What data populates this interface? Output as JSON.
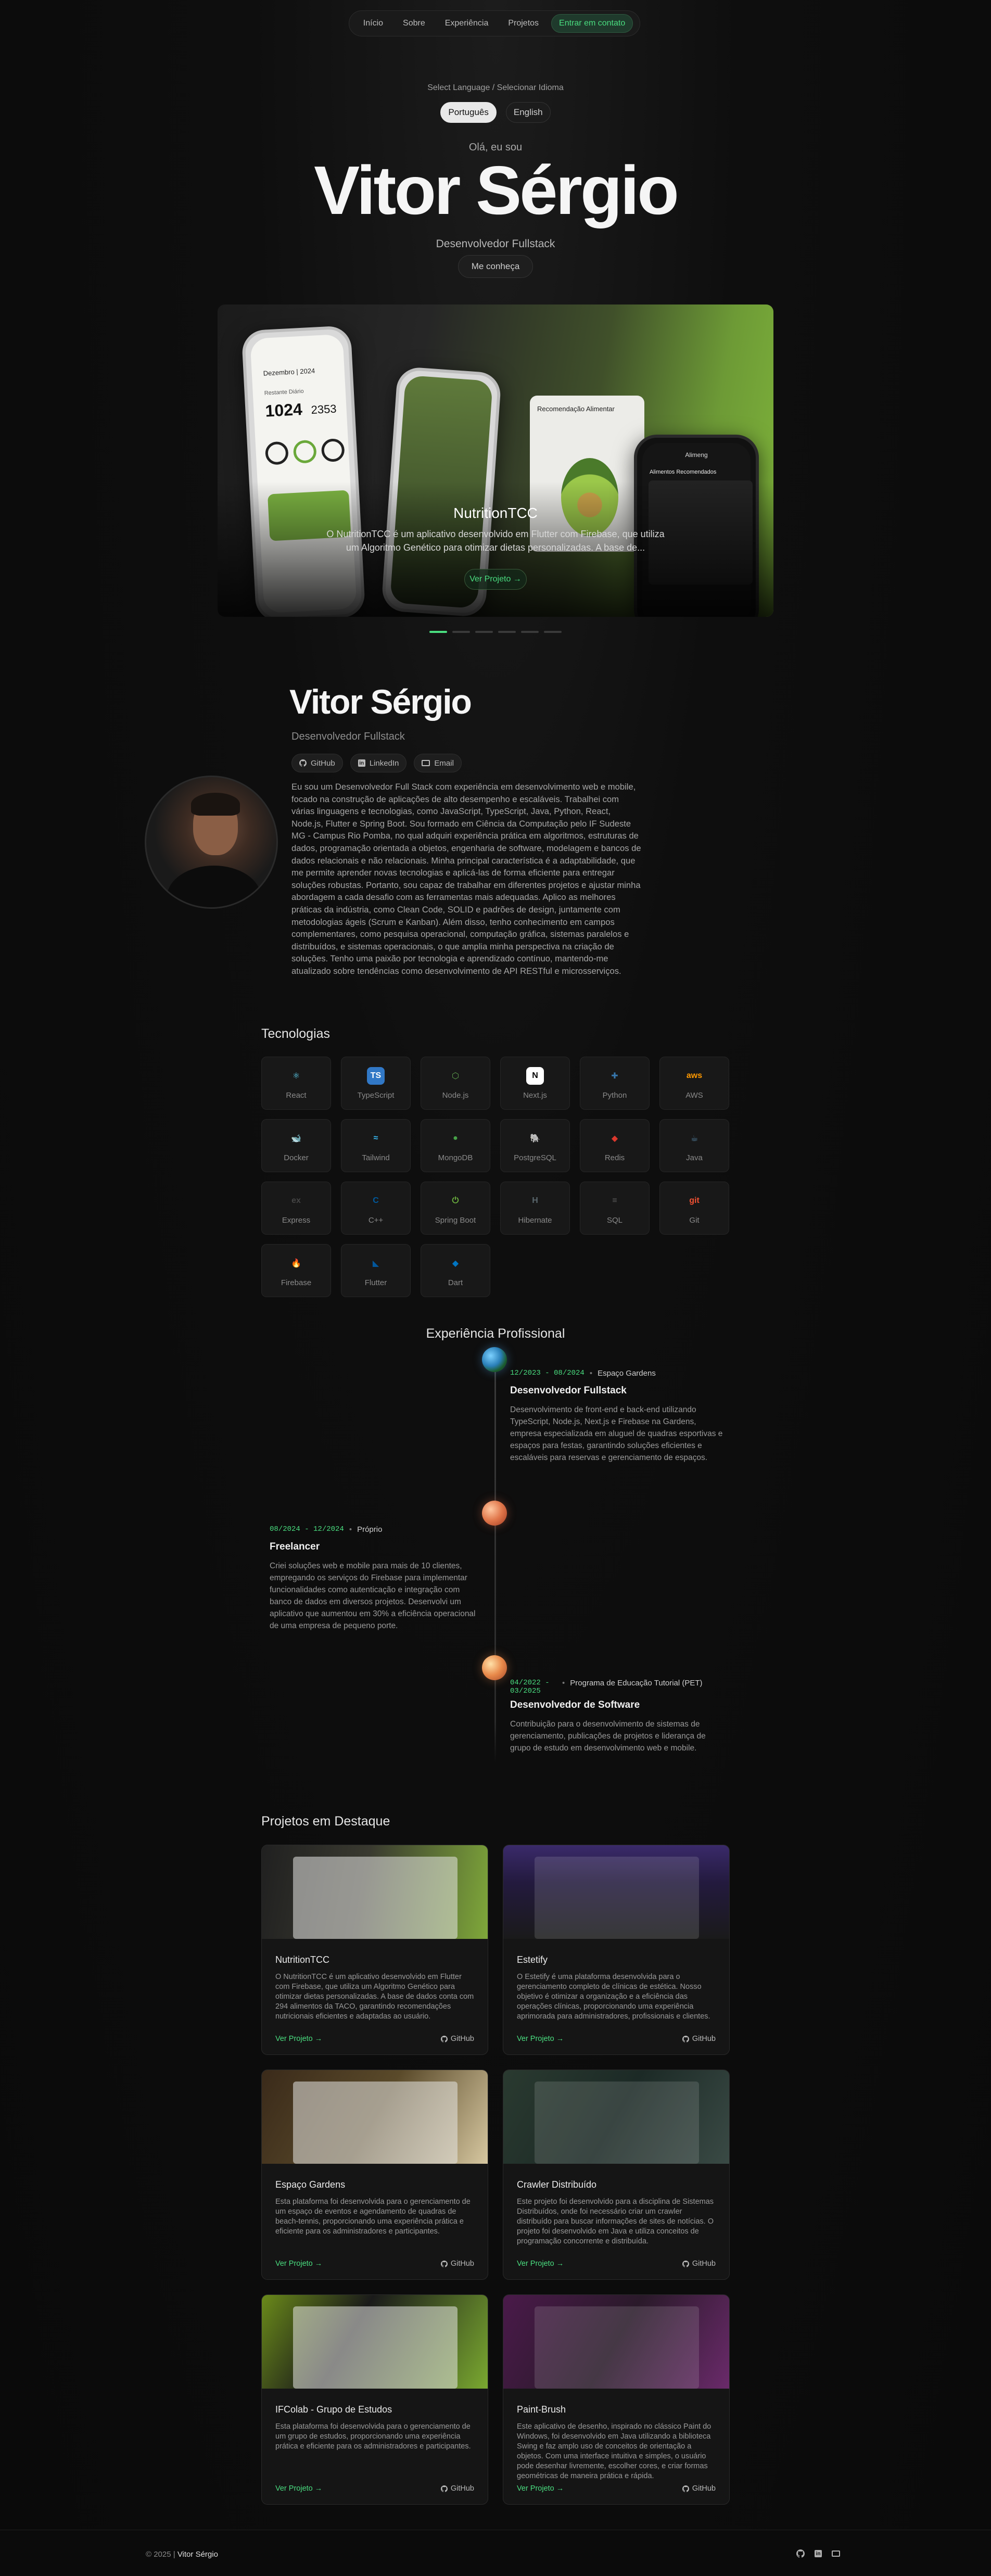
{
  "nav": {
    "items": [
      "Início",
      "Sobre",
      "Experiência",
      "Projetos"
    ],
    "cta": "Entrar em contato"
  },
  "hero": {
    "language_label": "Select Language / Selecionar Idioma",
    "languages": [
      "Português",
      "English"
    ],
    "active_language": "Português",
    "greeting": "Olá, eu sou",
    "name": "Vitor Sérgio",
    "role": "Desenvolvedor Fullstack",
    "meet_button": "Me conheça"
  },
  "carousel": {
    "title": "NutritionTCC",
    "description": "O NutritionTCC é um aplicativo desenvolvido em Flutter com Firebase, que utiliza um Algoritmo Genético para otimizar dietas personalizadas. A base de...",
    "button": "Ver Projeto →",
    "slides_count": 6,
    "active_slide": 1,
    "phone_texts": {
      "date": "Dezembro | 2024",
      "remaining": "Restante Diário",
      "kcal": "1024",
      "kcal2": "2353",
      "rec_title": "Recomendação Alimentar",
      "food_title": "Alimentos Recomendados",
      "brand": "Alimeng"
    }
  },
  "about": {
    "name": "Vitor Sérgio",
    "role": "Desenvolvedor Fullstack",
    "social": [
      "GitHub",
      "LinkedIn",
      "Email"
    ],
    "bio": "Eu sou um Desenvolvedor Full Stack com experiência em desenvolvimento web e mobile, focado na construção de aplicações de alto desempenho e escaláveis. Trabalhei com várias linguagens e tecnologias, como JavaScript, TypeScript, Java, Python, React, Node.js, Flutter e Spring Boot. Sou formado em Ciência da Computação pelo IF Sudeste MG - Campus Rio Pomba, no qual adquiri experiência prática em algoritmos, estruturas de dados, programação orientada a objetos, engenharia de software, modelagem e bancos de dados relacionais e não relacionais. Minha principal característica é a adaptabilidade, que me permite aprender novas tecnologias e aplicá-las de forma eficiente para entregar soluções robustas. Portanto, sou capaz de trabalhar em diferentes projetos e ajustar minha abordagem a cada desafio com as ferramentas mais adequadas. Aplico as melhores práticas da indústria, como Clean Code, SOLID e padrões de design, juntamente com metodologias ágeis (Scrum e Kanban). Além disso, tenho conhecimento em campos complementares, como pesquisa operacional, computação gráfica, sistemas paralelos e distribuídos, e sistemas operacionais, o que amplia minha perspectiva na criação de soluções. Tenho uma paixão por tecnologia e aprendizado contínuo, mantendo-me atualizado sobre tendências como desenvolvimento de API RESTful e microsserviços."
  },
  "tech": {
    "title": "Tecnologias",
    "items": [
      {
        "name": "React",
        "icon": "react-icon",
        "glyph": "⚛",
        "color": "#61dafb",
        "bg": "transparent"
      },
      {
        "name": "TypeScript",
        "icon": "typescript-icon",
        "glyph": "TS",
        "color": "#ffffff",
        "bg": "#3178c6"
      },
      {
        "name": "Node.js",
        "icon": "nodejs-icon",
        "glyph": "⬡",
        "color": "#5fa04e",
        "bg": "transparent"
      },
      {
        "name": "Next.js",
        "icon": "nextjs-icon",
        "glyph": "N",
        "color": "#000000",
        "bg": "#ffffff"
      },
      {
        "name": "Python",
        "icon": "python-icon",
        "glyph": "✚",
        "color": "#3776ab",
        "bg": "transparent"
      },
      {
        "name": "AWS",
        "icon": "aws-icon",
        "glyph": "aws",
        "color": "#ff9900",
        "bg": "transparent"
      },
      {
        "name": "Docker",
        "icon": "docker-icon",
        "glyph": "🐋",
        "color": "#2496ed",
        "bg": "transparent"
      },
      {
        "name": "Tailwind",
        "icon": "tailwind-icon",
        "glyph": "≈",
        "color": "#38bdf8",
        "bg": "transparent"
      },
      {
        "name": "MongoDB",
        "icon": "mongodb-icon",
        "glyph": "●",
        "color": "#47a248",
        "bg": "transparent"
      },
      {
        "name": "PostgreSQL",
        "icon": "postgresql-icon",
        "glyph": "🐘",
        "color": "#336791",
        "bg": "transparent"
      },
      {
        "name": "Redis",
        "icon": "redis-icon",
        "glyph": "◆",
        "color": "#dc382d",
        "bg": "transparent"
      },
      {
        "name": "Java",
        "icon": "java-icon",
        "glyph": "☕",
        "color": "#5382a1",
        "bg": "transparent"
      },
      {
        "name": "Express",
        "icon": "express-icon",
        "glyph": "ex",
        "color": "#444444",
        "bg": "transparent"
      },
      {
        "name": "C++",
        "icon": "cpp-icon",
        "glyph": "C",
        "color": "#00599c",
        "bg": "transparent"
      },
      {
        "name": "Spring Boot",
        "icon": "spring-boot-icon",
        "glyph": "⏻",
        "color": "#6db33f",
        "bg": "transparent"
      },
      {
        "name": "Hibernate",
        "icon": "hibernate-icon",
        "glyph": "H",
        "color": "#59666c",
        "bg": "transparent"
      },
      {
        "name": "SQL",
        "icon": "sql-icon",
        "glyph": "≡",
        "color": "#5a5a5a",
        "bg": "transparent"
      },
      {
        "name": "Git",
        "icon": "git-icon",
        "glyph": "git",
        "color": "#f05032",
        "bg": "transparent"
      },
      {
        "name": "Firebase",
        "icon": "firebase-icon",
        "glyph": "🔥",
        "color": "#ffca28",
        "bg": "transparent"
      },
      {
        "name": "Flutter",
        "icon": "flutter-icon",
        "glyph": "◣",
        "color": "#02569b",
        "bg": "transparent"
      },
      {
        "name": "Dart",
        "icon": "dart-icon",
        "glyph": "◆",
        "color": "#0175c2",
        "bg": "transparent"
      }
    ]
  },
  "experience": {
    "title": "Experiência Profissional",
    "items": [
      {
        "date": "12/2023 - 08/2024",
        "org": "Espaço Gardens",
        "role": "Desenvolvedor Fullstack",
        "desc": "Desenvolvimento de front-end e back-end utilizando TypeScript, Node.js, Next.js e Firebase na Gardens, empresa especializada em aluguel de quadras esportivas e espaços para festas, garantindo soluções eficientes e escaláveis para reservas e gerenciamento de espaços."
      },
      {
        "date": "08/2024 - 12/2024",
        "org": "Próprio",
        "role": "Freelancer",
        "desc": "Criei soluções web e mobile para mais de 10 clientes, empregando os serviços do Firebase para implementar funcionalidades como autenticação e integração com banco de dados em diversos projetos. Desenvolvi um aplicativo que aumentou em 30% a eficiência operacional de uma empresa de pequeno porte."
      },
      {
        "date": "04/2022 - 03/2025",
        "org": "Programa de Educação Tutorial (PET)",
        "role": "Desenvolvedor de Software",
        "desc": "Contribuição para o desenvolvimento de sistemas de gerenciamento, publicações de projetos e liderança de grupo de estudo em desenvolvimento web e mobile."
      }
    ]
  },
  "projects": {
    "title": "Projetos em Destaque",
    "view_label": "Ver Projeto →",
    "github_label": "GitHub",
    "items": [
      {
        "name": "NutritionTCC",
        "desc": "O NutritionTCC é um aplicativo desenvolvido em Flutter com Firebase, que utiliza um Algoritmo Genético para otimizar dietas personalizadas. A base de dados conta com 294 alimentos da TACO, garantindo recomendações nutricionais eficientes e adaptadas ao usuário."
      },
      {
        "name": "Estetify",
        "desc": "O Estetify é uma plataforma desenvolvida para o gerenciamento completo de clínicas de estética. Nosso objetivo é otimizar a organização e a eficiência das operações clínicas, proporcionando uma experiência aprimorada para administradores, profissionais e clientes."
      },
      {
        "name": "Espaço Gardens",
        "desc": "Esta plataforma foi desenvolvida para o gerenciamento de um espaço de eventos e agendamento de quadras de beach-tennis, proporcionando uma experiência prática e eficiente para os administradores e participantes."
      },
      {
        "name": "Crawler Distribuído",
        "desc": "Este projeto foi desenvolvido para a disciplina de Sistemas Distribuídos, onde foi necessário criar um crawler distribuído para buscar informações de sites de notícias. O projeto foi desenvolvido em Java e utiliza conceitos de programação concorrente e distribuída."
      },
      {
        "name": "IFColab - Grupo de Estudos",
        "desc": "Esta plataforma foi desenvolvida para o gerenciamento de um grupo de estudos, proporcionando uma experiência prática e eficiente para os administradores e participantes."
      },
      {
        "name": "Paint-Brush",
        "desc": "Este aplicativo de desenho, inspirado no clássico Paint do Windows, foi desenvolvido em Java utilizando a biblioteca Swing e faz amplo uso de conceitos de orientação a objetos. Com uma interface intuitiva e simples, o usuário pode desenhar livremente, escolher cores, e criar formas geométricas de maneira prática e rápida."
      }
    ]
  },
  "footer": {
    "copy": "© 2025 |",
    "name": "Vitor Sérgio",
    "icons": [
      "github-icon",
      "linkedin-icon",
      "email-icon"
    ]
  },
  "colors": {
    "accent": "#4ade80",
    "background": "#0a0a0a"
  }
}
